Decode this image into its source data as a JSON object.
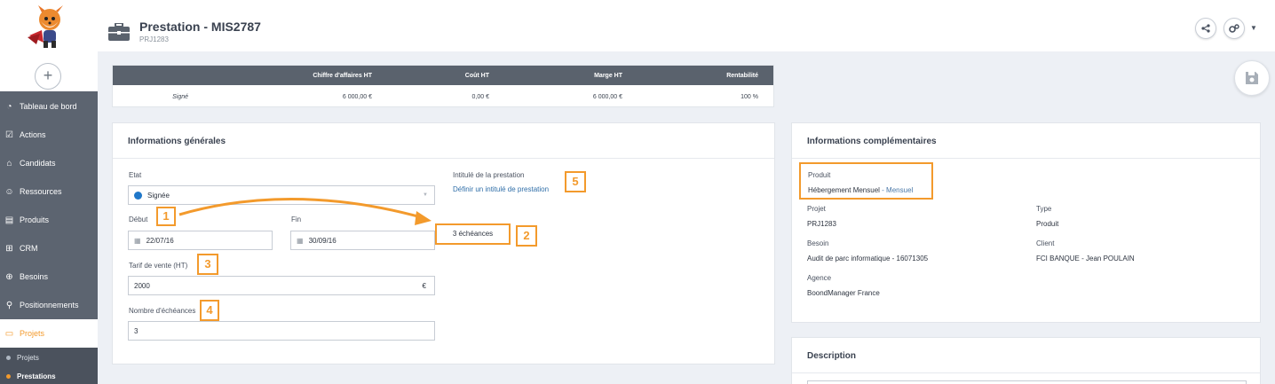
{
  "sidebar": {
    "add_label": "+",
    "items": [
      {
        "label": "Tableau de bord",
        "icon": "dashboard-icon"
      },
      {
        "label": "Actions",
        "icon": "checklist-icon"
      },
      {
        "label": "Candidats",
        "icon": "graduation-cap-icon"
      },
      {
        "label": "Ressources",
        "icon": "users-icon"
      },
      {
        "label": "Produits",
        "icon": "box-icon"
      },
      {
        "label": "CRM",
        "icon": "org-chart-icon"
      },
      {
        "label": "Besoins",
        "icon": "target-icon"
      },
      {
        "label": "Positionnements",
        "icon": "pin-icon"
      },
      {
        "label": "Projets",
        "icon": "briefcase-icon"
      }
    ],
    "sub_items": [
      {
        "label": "Projets"
      },
      {
        "label": "Prestations"
      }
    ]
  },
  "header": {
    "title": "Prestation - MIS2787",
    "subtitle": "PRJ1283"
  },
  "summary": {
    "headers": [
      "Chiffre d'affaires HT",
      "Coût HT",
      "Marge HT",
      "Rentabilité"
    ],
    "row": {
      "label": "Signé",
      "values": [
        "6 000,00 €",
        "0,00 €",
        "6 000,00 €",
        "100 %"
      ]
    }
  },
  "general": {
    "title": "Informations générales",
    "etat_label": "Etat",
    "etat_value": "Signée",
    "debut_label": "Début",
    "debut_value": "22/07/16",
    "fin_label": "Fin",
    "fin_value": "30/09/16",
    "tarif_label": "Tarif de vente (HT)",
    "tarif_value": "2000",
    "currency": "€",
    "nb_label": "Nombre d'échéances",
    "nb_value": "3",
    "intitule_label": "Intitulé de la prestation",
    "intitule_link": "Définir un intitulé de prestation",
    "echeances_button": "3 échéances"
  },
  "markers": [
    "1",
    "2",
    "3",
    "4",
    "5"
  ],
  "complementary": {
    "title": "Informations complémentaires",
    "produit_label": "Produit",
    "produit_value": "Hébergement Mensuel",
    "produit_suffix": "- Mensuel",
    "projet_label": "Projet",
    "projet_value": "PRJ1283",
    "type_label": "Type",
    "type_value": "Produit",
    "besoin_label": "Besoin",
    "besoin_value": "Audit de parc informatique  - 16071305",
    "client_label": "Client",
    "client_value": "FCI BANQUE  -  Jean POULAIN",
    "agence_label": "Agence",
    "agence_value": "BoondManager France"
  },
  "description": {
    "title": "Description"
  },
  "colors": {
    "accent": "#f39a2c",
    "sidebar": "#5c6470",
    "link": "#2f6ea8",
    "status": "#1f77c9"
  }
}
